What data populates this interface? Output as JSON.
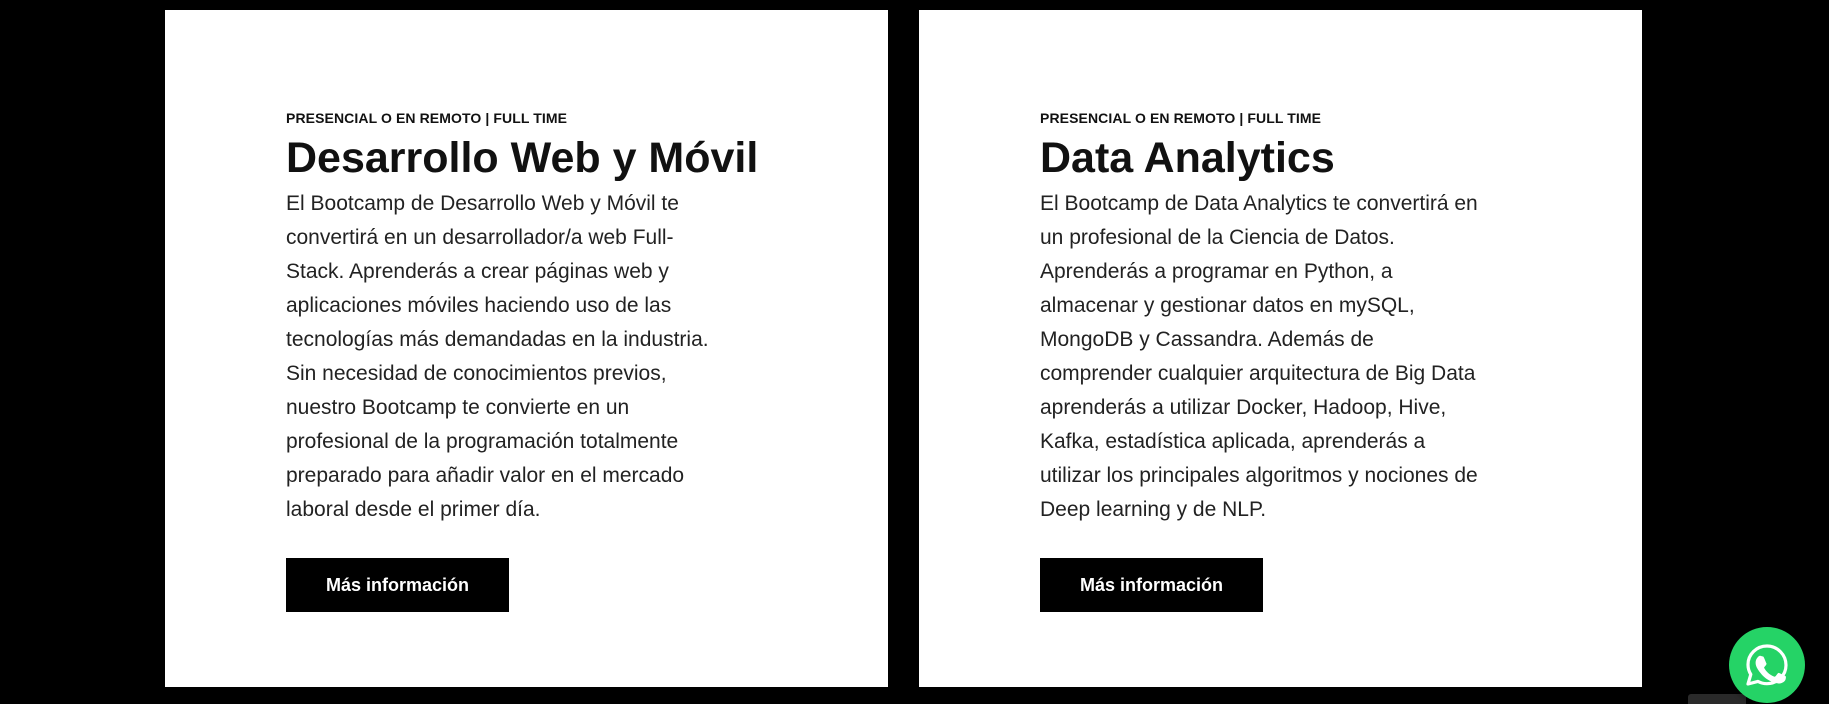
{
  "cards": [
    {
      "eyebrow": "PRESENCIAL O EN REMOTO | FULL TIME",
      "title": "Desarrollo Web y Móvil",
      "description_lines": [
        "El Bootcamp de Desarrollo Web y Móvil te",
        "convertirá en un desarrollador/a web Full-",
        "Stack. Aprenderás a crear páginas web y",
        "aplicaciones móviles haciendo uso de las",
        "tecnologías más demandadas en la industria.",
        "Sin necesidad de conocimientos previos,",
        "nuestro Bootcamp te convierte en un",
        "profesional de la programación totalmente",
        "preparado para añadir valor en el mercado",
        "laboral desde el primer día."
      ],
      "button_label": "Más información"
    },
    {
      "eyebrow": "PRESENCIAL O EN REMOTO | FULL TIME",
      "title": "Data Analytics",
      "description_lines": [
        "El Bootcamp de Data Analytics te convertirá en",
        "un profesional de la Ciencia de Datos.",
        "Aprenderás a programar en Python, a",
        "almacenar y gestionar datos en mySQL,",
        "MongoDB y Cassandra. Además de",
        "comprender cualquier arquitectura de Big Data",
        "aprenderás a utilizar Docker, Hadoop, Hive,",
        "Kafka, estadística aplicada, aprenderás a",
        "utilizar los principales algoritmos y nociones de",
        "Deep learning y de NLP."
      ],
      "button_label": "Más información"
    }
  ],
  "whatsapp": {
    "icon": "whatsapp-icon",
    "color": "#25d366"
  },
  "colors": {
    "page_background": "#000000",
    "card_background": "#ffffff",
    "button_background": "#000000"
  }
}
